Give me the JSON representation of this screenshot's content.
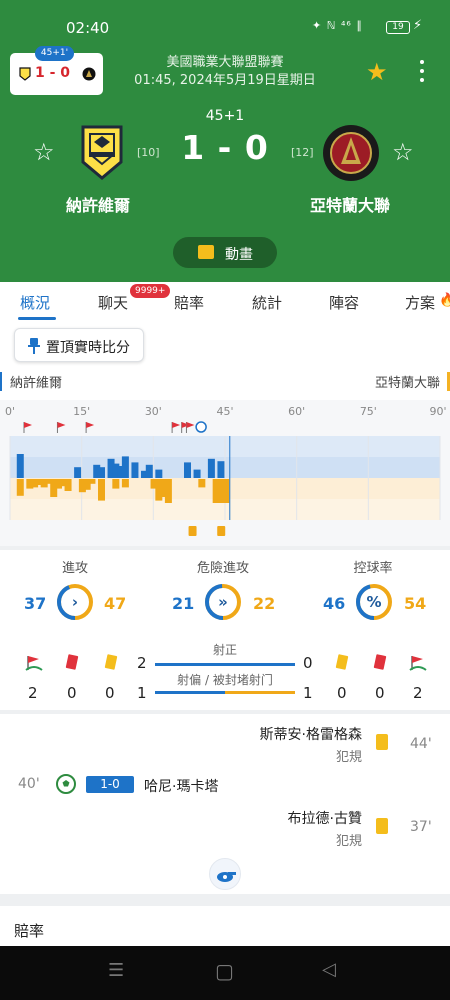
{
  "status": {
    "time": "02:40",
    "icons": "✦ ℕ ⁴⁶ ∥",
    "battery": "19"
  },
  "mini": {
    "minute": "45+1'",
    "score": "1 - 0"
  },
  "league": {
    "name": "美國職業大聯盟聯賽",
    "datetime": "01:45, 2024年5月19日星期日"
  },
  "match": {
    "minute": "45+1",
    "score": "1 - 0"
  },
  "home": {
    "name": "納許維爾",
    "rank": "[10]",
    "color": "#1e73c8"
  },
  "away": {
    "name": "亞特蘭大聯",
    "rank": "[12]",
    "color": "#f0a818"
  },
  "animation_label": "動畫",
  "tabs": [
    {
      "label": "概況",
      "active": true
    },
    {
      "label": "聊天",
      "badge": "9999+"
    },
    {
      "label": "賠率"
    },
    {
      "label": "統計"
    },
    {
      "label": "陣容"
    },
    {
      "label": "方案"
    }
  ],
  "pin_label": "置頂實時比分",
  "timeline": {
    "ticks": [
      "0'",
      "15'",
      "30'",
      "45'",
      "60'",
      "75'",
      "90'"
    ],
    "current_minute": 46,
    "home_attacks": [
      1,
      0,
      0,
      0,
      0,
      0,
      0,
      1,
      0,
      0,
      0,
      0,
      0,
      1,
      0,
      0,
      0,
      0,
      0,
      0,
      0,
      0,
      0,
      0,
      0,
      0,
      0,
      0,
      0,
      0,
      0,
      1,
      0,
      1,
      1,
      0,
      0,
      0,
      1,
      0,
      1,
      0,
      0,
      1,
      0,
      0
    ],
    "home_bars": [
      0,
      1.0,
      0,
      0,
      0,
      0,
      0,
      0,
      0,
      0,
      0,
      0,
      0,
      0.45,
      0,
      0,
      0,
      0.55,
      0.45,
      0,
      0.8,
      0.6,
      0.5,
      0.9,
      0,
      0.65,
      0,
      0.3,
      0.55,
      0,
      0.35,
      0,
      0,
      0,
      0,
      0,
      0.65,
      0,
      0.35,
      0,
      0,
      0.8,
      0,
      0.7,
      0,
      0
    ],
    "away_bars": [
      0,
      0.7,
      0,
      0.4,
      0.35,
      0.25,
      0.35,
      0.2,
      0.75,
      0.4,
      0.3,
      0.5,
      0,
      0,
      0.55,
      0.45,
      0.2,
      0,
      0.9,
      0,
      0,
      0.4,
      0,
      0.35,
      0,
      0,
      0,
      0,
      0,
      0.4,
      0.9,
      0.75,
      1.0,
      0,
      0,
      0,
      0,
      0,
      0,
      0.35,
      0,
      0,
      1.0,
      1.0,
      1.0,
      0
    ]
  },
  "stats": [
    {
      "title": "進攻",
      "home": "37",
      "away": "47",
      "home_share": 0.44,
      "icon": "›"
    },
    {
      "title": "危險進攻",
      "home": "21",
      "away": "22",
      "home_share": 0.49,
      "icon": "»"
    },
    {
      "title": "控球率",
      "home": "46",
      "away": "54",
      "home_share": 0.46,
      "icon": "%"
    }
  ],
  "cards": {
    "home": {
      "corners": "2",
      "red": "0",
      "yellow": "0"
    },
    "away": {
      "corners": "2",
      "red": "0",
      "yellow": "0"
    }
  },
  "shots_on_target": {
    "label": "射正",
    "home": "2",
    "away": "0",
    "home_share": 1.0
  },
  "shots_off": {
    "label": "射偏 / 被封堵射门",
    "home": "1",
    "away": "1",
    "home_share": 0.5
  },
  "events": [
    {
      "minute": "44'",
      "player": "斯蒂安·格雷格森",
      "detail": "犯規",
      "side": "away",
      "type": "yellow"
    },
    {
      "minute": "40'",
      "player": "哈尼·瑪卡塔",
      "score": "1-0",
      "side": "home",
      "type": "goal"
    },
    {
      "minute": "37'",
      "player": "布拉德·古贊",
      "detail": "犯規",
      "side": "away",
      "type": "yellow"
    }
  ],
  "odds_title": "賠率",
  "nav": {
    "menu": "☰",
    "home": "▢",
    "back": "◁"
  }
}
